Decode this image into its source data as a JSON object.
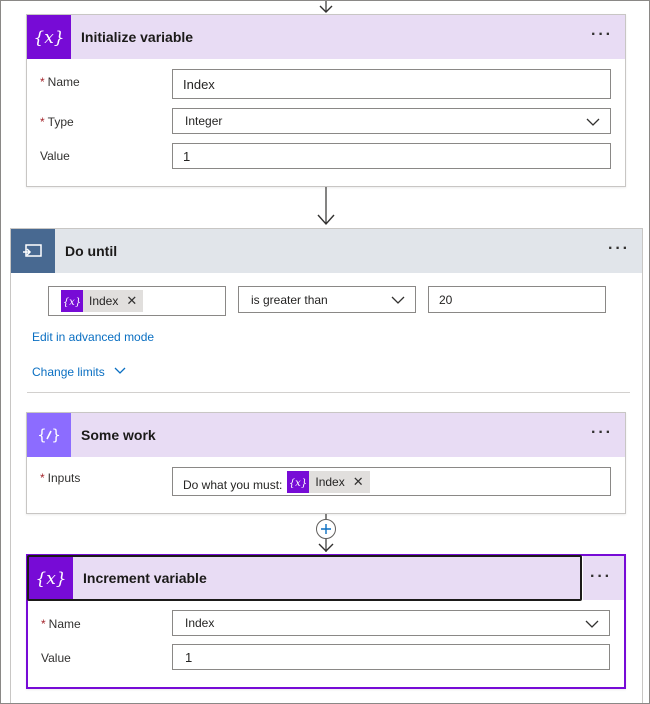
{
  "init_var": {
    "title": "Initialize variable",
    "more": "···",
    "name_label": "Name",
    "name_value": "Index",
    "type_label": "Type",
    "type_value": "Integer",
    "value_label": "Value",
    "value_value": "1",
    "required_mark": "*"
  },
  "do_until": {
    "title": "Do until",
    "more": "···",
    "condition_token": "Index",
    "operator": "is greater than",
    "compare_value": "20",
    "advanced_link": "Edit in advanced mode",
    "limits_link": "Change limits"
  },
  "some_work": {
    "title": "Some work",
    "more": "···",
    "inputs_label": "Inputs",
    "inputs_prefix": "Do what you must:",
    "inputs_token": "Index",
    "required_mark": "*"
  },
  "increment_var": {
    "title": "Increment variable",
    "more": "···",
    "name_label": "Name",
    "name_value": "Index",
    "value_label": "Value",
    "value_value": "1",
    "required_mark": "*"
  },
  "icons": {
    "variable": "variable-icon",
    "loop": "do-until-icon",
    "compose": "compose-icon",
    "add": "plus-icon",
    "chevron": "chevron-down-icon"
  },
  "colors": {
    "variable_accent": "#770bd6",
    "compose_accent": "#8c6cff",
    "control_accent": "#486991",
    "header_tint": "#e8dcf4",
    "link": "#0a6fc2",
    "required": "#a4262c"
  }
}
